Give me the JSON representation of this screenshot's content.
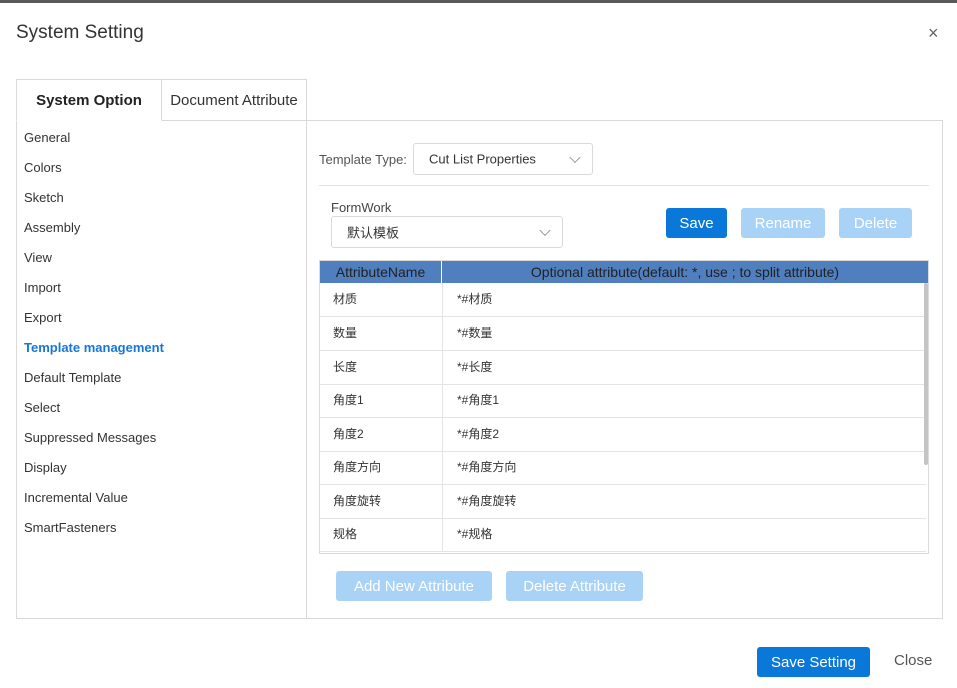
{
  "dialog": {
    "title": "System Setting",
    "close_glyph": "×"
  },
  "tabs": {
    "system_option": "System Option",
    "document_attribute": "Document Attribute"
  },
  "menu": {
    "items": [
      {
        "label": "General"
      },
      {
        "label": "Colors"
      },
      {
        "label": "Sketch"
      },
      {
        "label": "Assembly"
      },
      {
        "label": "View"
      },
      {
        "label": "Import"
      },
      {
        "label": "Export"
      },
      {
        "label": "Template management"
      },
      {
        "label": "Default Template"
      },
      {
        "label": "Select"
      },
      {
        "label": "Suppressed Messages"
      },
      {
        "label": "Display"
      },
      {
        "label": "Incremental Value"
      },
      {
        "label": "SmartFasteners"
      }
    ],
    "active": "Template management"
  },
  "template": {
    "type_label": "Template Type:",
    "type_value": "Cut List Properties",
    "formwork_label": "FormWork",
    "formwork_value": "默认模板",
    "save_label": "Save",
    "rename_label": "Rename",
    "delete_label": "Delete"
  },
  "grid": {
    "columns": [
      "AttributeName",
      "Optional attribute(default: *, use ; to split attribute)"
    ],
    "rows": [
      [
        "材质",
        "*#材质"
      ],
      [
        "数量",
        "*#数量"
      ],
      [
        "长度",
        "*#长度"
      ],
      [
        "角度1",
        "*#角度1"
      ],
      [
        "角度2",
        "*#角度2"
      ],
      [
        "角度方向",
        "*#角度方向"
      ],
      [
        "角度旋转",
        "*#角度旋转"
      ],
      [
        "规格",
        "*#规格"
      ]
    ]
  },
  "attribute_buttons": {
    "add": "Add New Attribute",
    "delete": "Delete Attribute"
  },
  "footer": {
    "save_setting": "Save Setting",
    "close": "Close"
  },
  "colors": {
    "accent": "#0a78d8",
    "disabled": "#a9d2f7",
    "header": "#4f7fbf",
    "active_menu": "#1677d8"
  }
}
